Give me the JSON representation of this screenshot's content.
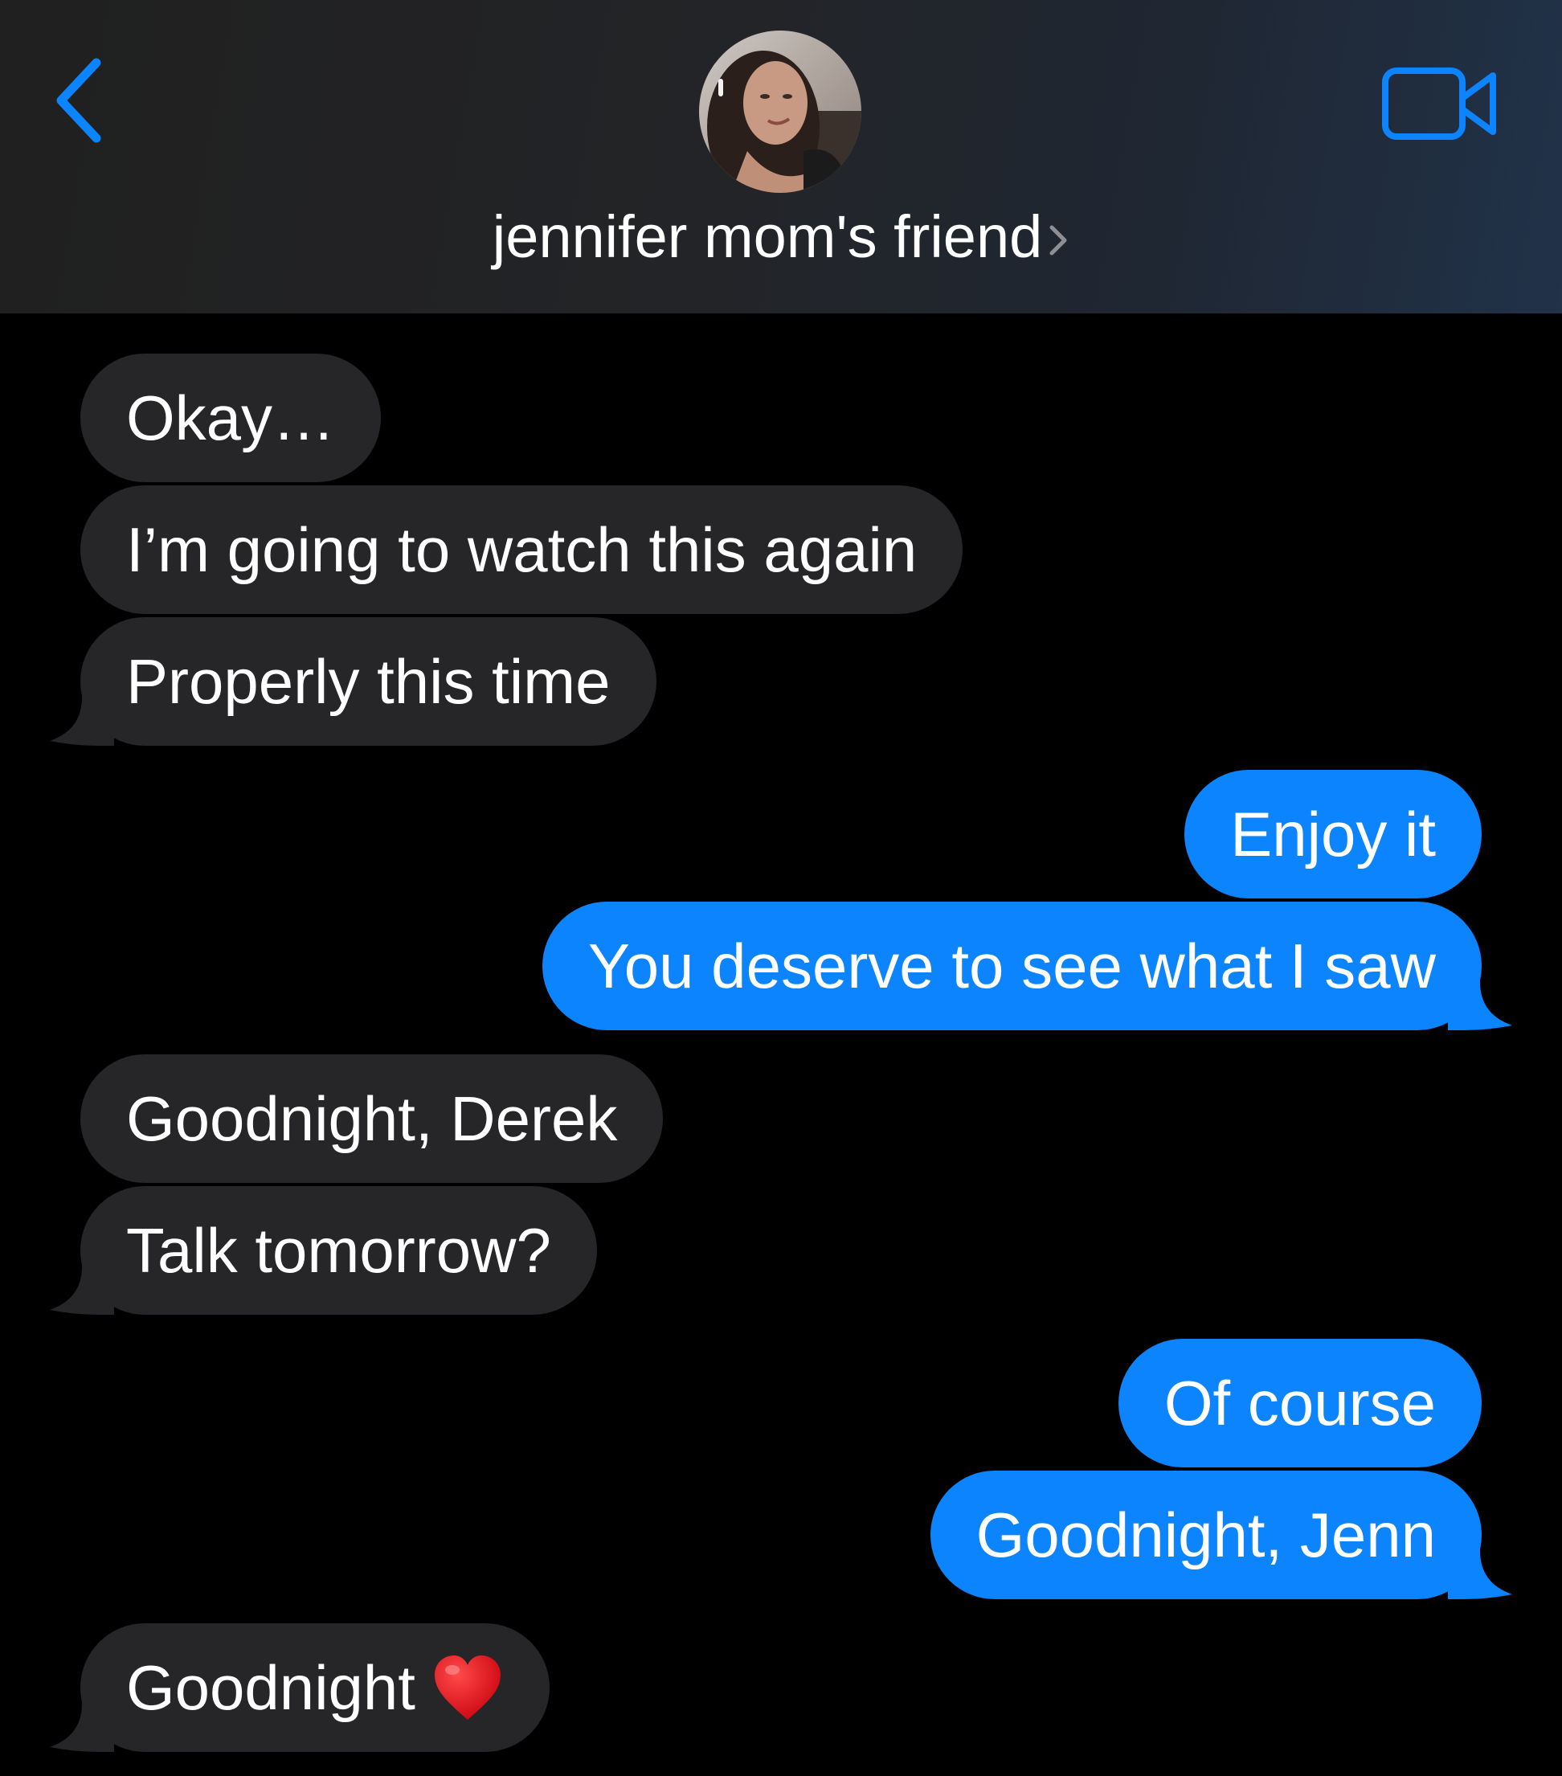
{
  "header": {
    "contact_name": "jennifer mom's friend",
    "back_icon": "chevron-left-icon",
    "video_icon": "video-camera-icon",
    "accent_color": "#0b84fe"
  },
  "messages": [
    {
      "side": "in",
      "text": "Okay…"
    },
    {
      "side": "in",
      "text": "I’m going to watch this again"
    },
    {
      "side": "in",
      "text": "Properly this time"
    },
    {
      "side": "out",
      "text": "Enjoy it"
    },
    {
      "side": "out",
      "text": "You deserve to see what I saw"
    },
    {
      "side": "in",
      "text": "Goodnight, Derek"
    },
    {
      "side": "in",
      "text": "Talk tomorrow?"
    },
    {
      "side": "out",
      "text": "Of course"
    },
    {
      "side": "out",
      "text": "Goodnight, Jenn"
    },
    {
      "side": "in",
      "text": "Goodnight",
      "emoji": "heart-icon"
    }
  ],
  "colors": {
    "incoming_bubble": "#262629",
    "outgoing_bubble": "#0b84fe",
    "background": "#000000"
  }
}
